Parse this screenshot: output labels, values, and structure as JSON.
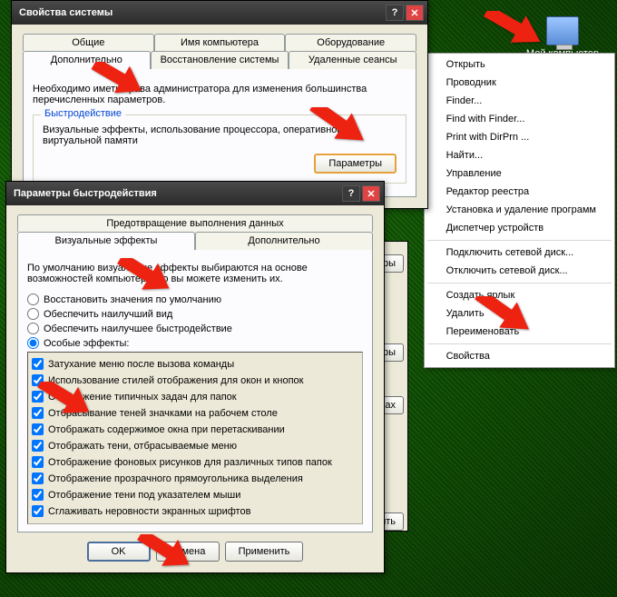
{
  "desktop": {
    "mycomputer": "Мой компьютер"
  },
  "context": {
    "items": [
      "Открыть",
      "Проводник",
      "Finder...",
      "Find with Finder...",
      "Print with DirPrn ...",
      "Найти...",
      "Управление",
      "Редактор реестра",
      "Установка и удаление программ",
      "Диспетчер устройств"
    ],
    "items2": [
      "Подключить сетевой диск...",
      "Отключить сетевой диск..."
    ],
    "items3": [
      "Создать ярлык",
      "Удалить",
      "Переименовать"
    ],
    "items4": [
      "Свойства"
    ]
  },
  "sysprops": {
    "title": "Свойства системы",
    "tabs_row1": [
      "Общие",
      "Имя компьютера",
      "Оборудование"
    ],
    "tabs_row2": [
      "Дополнительно",
      "Восстановление системы",
      "Удаленные сеансы"
    ],
    "desc": "Необходимо иметь права администратора для изменения большинства перечисленных параметров.",
    "perf_title": "Быстродействие",
    "perf_desc": "Визуальные эффекты, использование процессора, оперативной и виртуальной памяти",
    "params_btn": "Параметры"
  },
  "partial": {
    "b1": "тры",
    "b2": "тры",
    "b3": "бках",
    "b4": "менить"
  },
  "perf": {
    "title": "Параметры быстродействия",
    "dep_tab": "Предотвращение выполнения данных",
    "tabs": [
      "Визуальные эффекты",
      "Дополнительно"
    ],
    "desc": "По умолчанию визуальные эффекты выбираются на основе возможностей компьютера, но вы можете изменить их.",
    "radios": [
      "Восстановить значения по умолчанию",
      "Обеспечить наилучший вид",
      "Обеспечить наилучшее быстродействие",
      "Особые эффекты:"
    ],
    "checks": [
      "Затухание меню после вызова команды",
      "Использование стилей отображения для окон и кнопок",
      "Отображение типичных задач для папок",
      "Отбрасывание теней значками на рабочем столе",
      "Отображать содержимое окна при перетаскивании",
      "Отображать тени, отбрасываемые меню",
      "Отображение фоновых рисунков для различных типов папок",
      "Отображение прозрачного прямоугольника выделения",
      "Отображение тени под указателем мыши",
      "Сглаживать неровности экранных шрифтов"
    ],
    "ok": "OK",
    "cancel": "Отмена",
    "apply": "Применить"
  }
}
